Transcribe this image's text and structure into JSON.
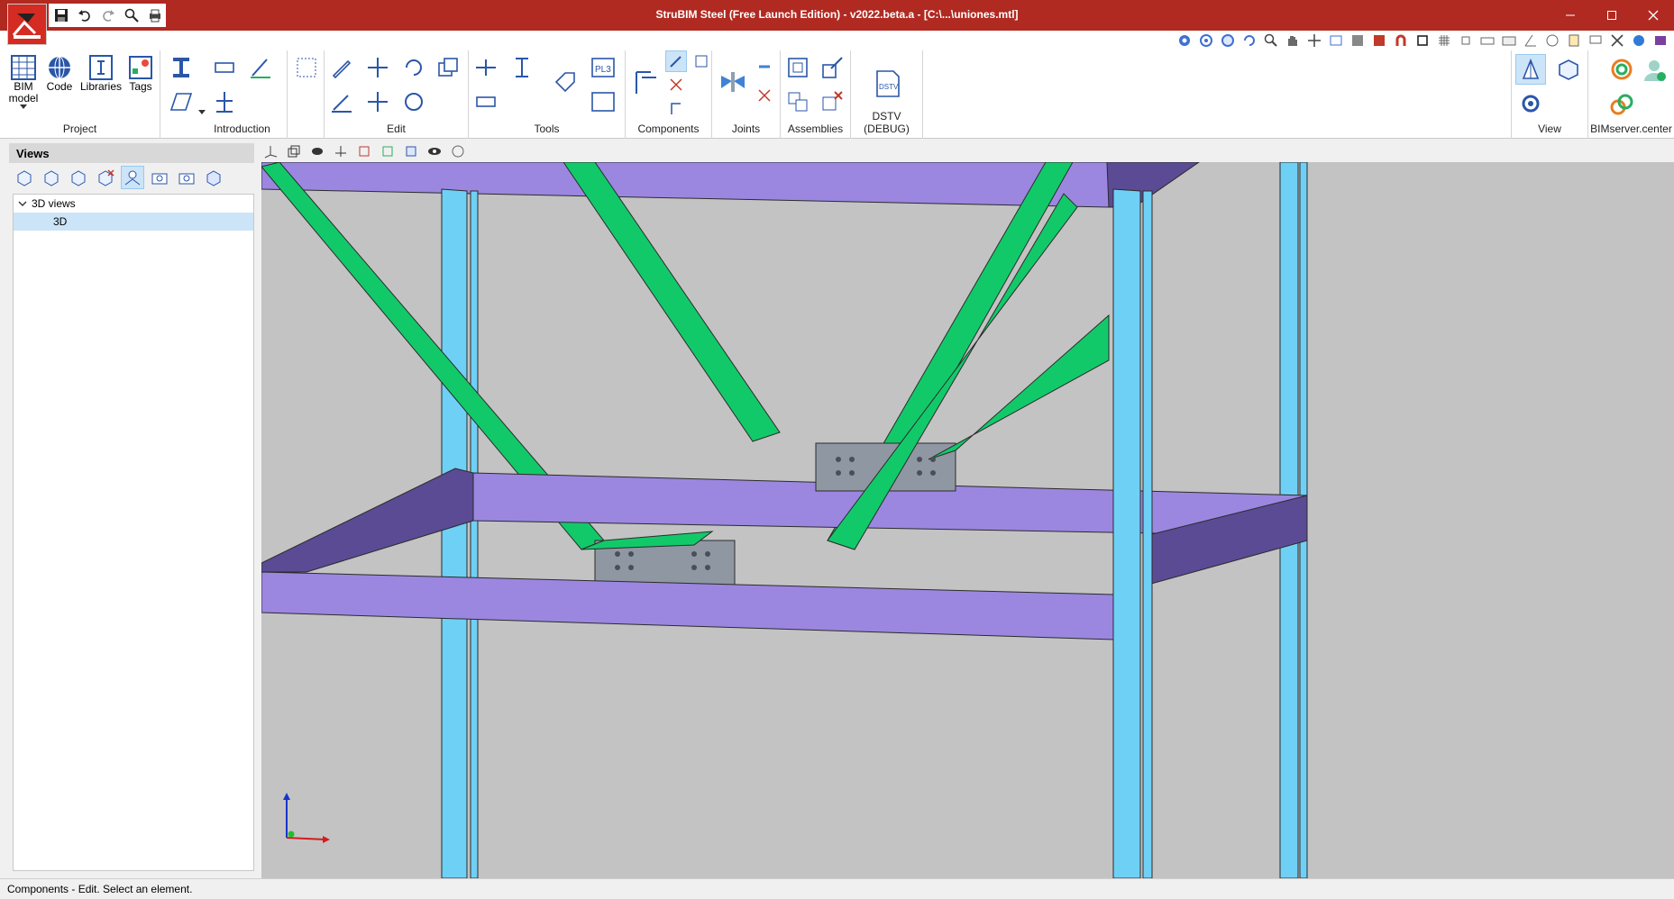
{
  "window": {
    "title": "StruBIM Steel (Free Launch Edition) - v2022.beta.a - [C:\\...\\uniones.mtl]",
    "accent_color": "#b02a22"
  },
  "quick_access": [
    "save-icon",
    "undo-icon",
    "redo-icon",
    "zoom-icon",
    "print-icon"
  ],
  "ribbon": {
    "groups": {
      "project": "Project",
      "introduction": "Introduction",
      "edit": "Edit",
      "tools": "Tools",
      "components": "Components",
      "joints": "Joints",
      "assemblies": "Assemblies",
      "dstv": "DSTV (DEBUG)",
      "view": "View",
      "bimserver": "BIMserver.center"
    },
    "buttons": {
      "bim_model": "BIM model",
      "code": "Code",
      "libraries": "Libraries",
      "tags": "Tags",
      "pl3": "PL3",
      "dstv": "DSTV"
    }
  },
  "views_panel": {
    "title": "Views",
    "tree": {
      "group_label": "3D views",
      "item_label": "3D"
    }
  },
  "status": "Components - Edit. Select an element.",
  "colors": {
    "beam": "#9b87e0",
    "beam_dark": "#5b4b94",
    "column": "#6fd0f5",
    "brace": "#12c96a",
    "plate": "#8f97a3",
    "background": "#c3c3c3"
  }
}
